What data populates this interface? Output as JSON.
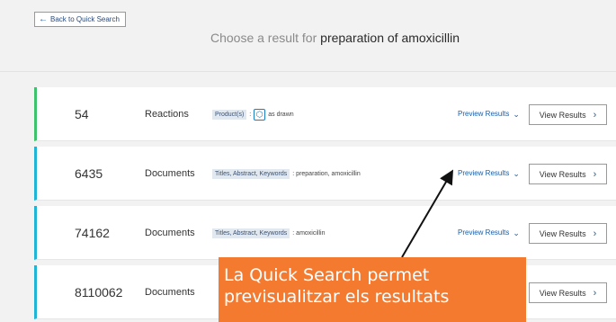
{
  "header": {
    "back_label": "Back to Quick Search",
    "heading_prefix": "Choose a result for",
    "heading_query": "preparation of amoxicillin"
  },
  "results": [
    {
      "count": "54",
      "type": "Reactions",
      "tag": "Product(s)",
      "separator": ":",
      "filter_text": "as drawn",
      "preview_label": "Preview Results",
      "view_label": "View Results"
    },
    {
      "count": "6435",
      "type": "Documents",
      "tag": "Titles, Abstract, Keywords",
      "filter_text": ": preparation, amoxicillin",
      "preview_label": "Preview Results",
      "view_label": "View Results"
    },
    {
      "count": "74162",
      "type": "Documents",
      "tag": "Titles, Abstract, Keywords",
      "filter_text": ": amoxicillin",
      "preview_label": "Preview Results",
      "view_label": "View Results"
    },
    {
      "count": "8110062",
      "type": "Documents",
      "view_label": "View Results"
    }
  ],
  "callout": {
    "line1": "La Quick Search permet",
    "line2": "previsualitzar els resultats"
  },
  "colors": {
    "reaction_bar": "#3cc36b",
    "document_bar": "#1fb5d6",
    "link": "#1a5ea8",
    "callout_bg": "#f47a2f"
  },
  "icons": {
    "back": "arrow-left-icon",
    "structure": "hexagon-structure-icon",
    "preview": "chevron-down-icon",
    "view": "chevron-right-icon"
  }
}
